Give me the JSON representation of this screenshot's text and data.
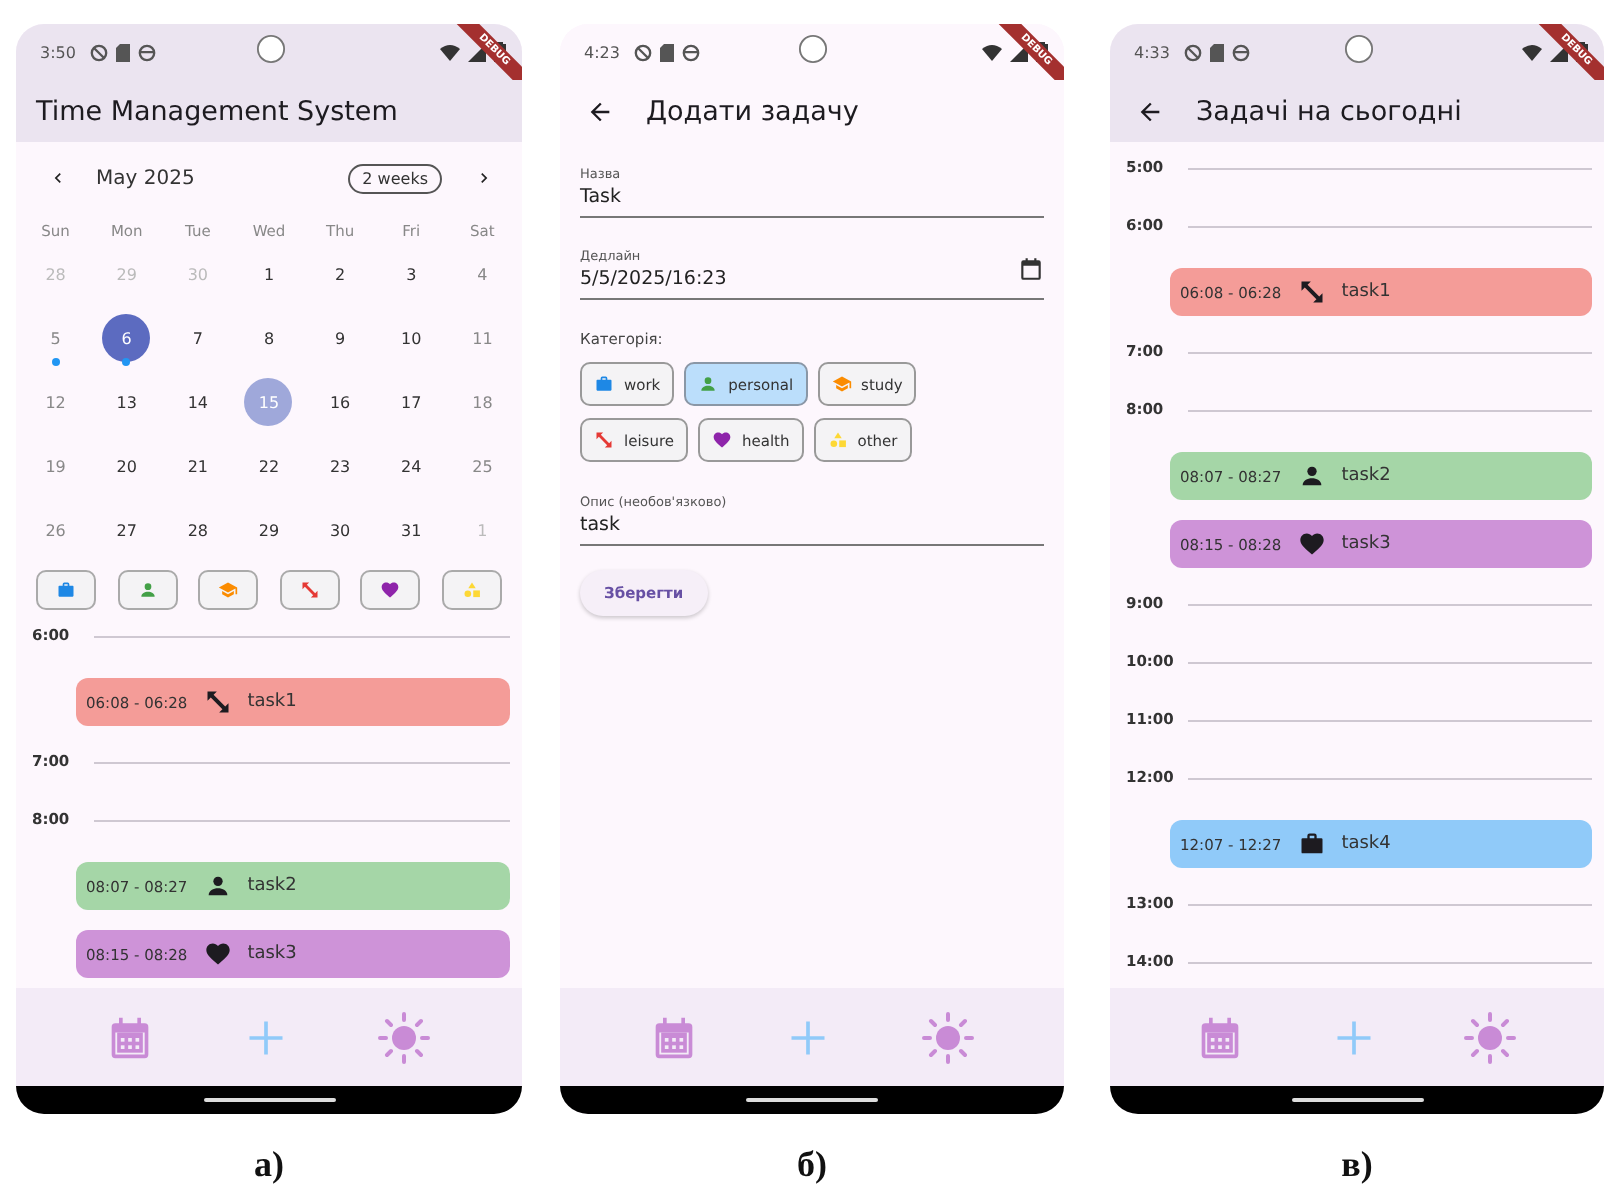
{
  "panels": [
    {
      "kind": "calendar",
      "caption": "а)",
      "status_time": "3:50",
      "banner": "DEBUG",
      "app_bar": {
        "title": "Time Management System",
        "back": false,
        "tinted": true
      },
      "calendar": {
        "month": "May 2025",
        "format_button": "2 weeks",
        "weekdays": [
          "Sun",
          "Mon",
          "Tue",
          "Wed",
          "Thu",
          "Fri",
          "Sat"
        ],
        "weeks": [
          [
            {
              "day": "28",
              "outside": true,
              "selected": false,
              "today": false,
              "event": false
            },
            {
              "day": "29",
              "outside": true,
              "selected": false,
              "today": false,
              "event": false
            },
            {
              "day": "30",
              "outside": true,
              "selected": false,
              "today": false,
              "event": false
            },
            {
              "day": "1",
              "outside": false,
              "selected": false,
              "today": false,
              "event": false
            },
            {
              "day": "2",
              "outside": false,
              "selected": false,
              "today": false,
              "event": false
            },
            {
              "day": "3",
              "outside": false,
              "selected": false,
              "today": false,
              "event": false
            },
            {
              "day": "4",
              "outside": false,
              "selected": false,
              "today": false,
              "event": false
            }
          ],
          [
            {
              "day": "5",
              "outside": false,
              "selected": false,
              "today": false,
              "event": true
            },
            {
              "day": "6",
              "outside": false,
              "selected": true,
              "today": false,
              "event": true
            },
            {
              "day": "7",
              "outside": false,
              "selected": false,
              "today": false,
              "event": false
            },
            {
              "day": "8",
              "outside": false,
              "selected": false,
              "today": false,
              "event": false
            },
            {
              "day": "9",
              "outside": false,
              "selected": false,
              "today": false,
              "event": false
            },
            {
              "day": "10",
              "outside": false,
              "selected": false,
              "today": false,
              "event": false
            },
            {
              "day": "11",
              "outside": false,
              "selected": false,
              "today": false,
              "event": false
            }
          ],
          [
            {
              "day": "12",
              "outside": false,
              "selected": false,
              "today": false,
              "event": false
            },
            {
              "day": "13",
              "outside": false,
              "selected": false,
              "today": false,
              "event": false
            },
            {
              "day": "14",
              "outside": false,
              "selected": false,
              "today": false,
              "event": false
            },
            {
              "day": "15",
              "outside": false,
              "selected": false,
              "today": true,
              "event": false
            },
            {
              "day": "16",
              "outside": false,
              "selected": false,
              "today": false,
              "event": false
            },
            {
              "day": "17",
              "outside": false,
              "selected": false,
              "today": false,
              "event": false
            },
            {
              "day": "18",
              "outside": false,
              "selected": false,
              "today": false,
              "event": false
            }
          ],
          [
            {
              "day": "19",
              "outside": false,
              "selected": false,
              "today": false,
              "event": false
            },
            {
              "day": "20",
              "outside": false,
              "selected": false,
              "today": false,
              "event": false
            },
            {
              "day": "21",
              "outside": false,
              "selected": false,
              "today": false,
              "event": false
            },
            {
              "day": "22",
              "outside": false,
              "selected": false,
              "today": false,
              "event": false
            },
            {
              "day": "23",
              "outside": false,
              "selected": false,
              "today": false,
              "event": false
            },
            {
              "day": "24",
              "outside": false,
              "selected": false,
              "today": false,
              "event": false
            },
            {
              "day": "25",
              "outside": false,
              "selected": false,
              "today": false,
              "event": false
            }
          ],
          [
            {
              "day": "26",
              "outside": false,
              "selected": false,
              "today": false,
              "event": false
            },
            {
              "day": "27",
              "outside": false,
              "selected": false,
              "today": false,
              "event": false
            },
            {
              "day": "28",
              "outside": false,
              "selected": false,
              "today": false,
              "event": false
            },
            {
              "day": "29",
              "outside": false,
              "selected": false,
              "today": false,
              "event": false
            },
            {
              "day": "30",
              "outside": false,
              "selected": false,
              "today": false,
              "event": false
            },
            {
              "day": "31",
              "outside": false,
              "selected": false,
              "today": false,
              "event": false
            },
            {
              "day": "1",
              "outside": true,
              "selected": false,
              "today": false,
              "event": false
            }
          ]
        ]
      },
      "filters": [
        {
          "kind": "work",
          "color": "#1e88e5"
        },
        {
          "kind": "personal",
          "color": "#43a047"
        },
        {
          "kind": "study",
          "color": "#fb8c00"
        },
        {
          "kind": "leisure",
          "color": "#e53935"
        },
        {
          "kind": "health",
          "color": "#8e24aa"
        },
        {
          "kind": "other",
          "color": "#fdd835"
        }
      ],
      "timeline": [
        {
          "kind": "hour",
          "label": "6:00"
        },
        {
          "kind": "leisure",
          "time": "06:08 - 06:28",
          "name": "task1",
          "color": "#f49c98"
        },
        {
          "kind": "hour",
          "label": "7:00"
        },
        {
          "kind": "hour",
          "label": "8:00"
        },
        {
          "kind": "personal",
          "time": "08:07 - 08:27",
          "name": "task2",
          "color": "#a5d6a7"
        },
        {
          "kind": "health",
          "time": "08:15 - 08:28",
          "name": "task3",
          "color": "#ce93d8"
        }
      ]
    },
    {
      "kind": "form",
      "caption": "б)",
      "status_time": "4:23",
      "banner": "DEBUG",
      "app_bar": {
        "title": "Додати задачу",
        "back": true,
        "tinted": false
      },
      "form": {
        "fields": [
          {
            "label": "Назва",
            "value": "Task",
            "calendar_button": false
          },
          {
            "label": "Дедлайн",
            "value": "5/5/2025/16:23",
            "calendar_button": true
          }
        ],
        "category_label": "Категорія:",
        "categories": [
          {
            "label": "work",
            "kind": "work",
            "color": "#1e88e5",
            "selected": false
          },
          {
            "label": "personal",
            "kind": "personal",
            "color": "#43a047",
            "selected": true
          },
          {
            "label": "study",
            "kind": "study",
            "color": "#fb8c00",
            "selected": false
          },
          {
            "label": "leisure",
            "kind": "leisure",
            "color": "#e53935",
            "selected": false
          },
          {
            "label": "health",
            "kind": "health",
            "color": "#8e24aa",
            "selected": false
          },
          {
            "label": "other",
            "kind": "other",
            "color": "#fdd835",
            "selected": false
          }
        ],
        "description": {
          "label": "Опис (необов'язково)",
          "value": "task"
        },
        "save_button": "Зберегти"
      }
    },
    {
      "kind": "agenda",
      "caption": "в)",
      "status_time": "4:33",
      "banner": "DEBUG",
      "app_bar": {
        "title": "Задачі на сьогодні",
        "back": true,
        "tinted": true
      },
      "timeline": [
        {
          "kind": "hour",
          "label": "5:00"
        },
        {
          "kind": "hour",
          "label": "6:00"
        },
        {
          "kind": "leisure",
          "time": "06:08 - 06:28",
          "name": "task1",
          "color": "#f49c98"
        },
        {
          "kind": "hour",
          "label": "7:00"
        },
        {
          "kind": "hour",
          "label": "8:00"
        },
        {
          "kind": "personal",
          "time": "08:07 - 08:27",
          "name": "task2",
          "color": "#a5d6a7"
        },
        {
          "kind": "health",
          "time": "08:15 - 08:28",
          "name": "task3",
          "color": "#ce93d8"
        },
        {
          "kind": "hour",
          "label": "9:00"
        },
        {
          "kind": "hour",
          "label": "10:00"
        },
        {
          "kind": "hour",
          "label": "11:00"
        },
        {
          "kind": "hour",
          "label": "12:00"
        },
        {
          "kind": "work",
          "time": "12:07 - 12:27",
          "name": "task4",
          "color": "#90caf9"
        },
        {
          "kind": "hour",
          "label": "13:00"
        },
        {
          "kind": "hour",
          "label": "14:00"
        }
      ]
    }
  ]
}
